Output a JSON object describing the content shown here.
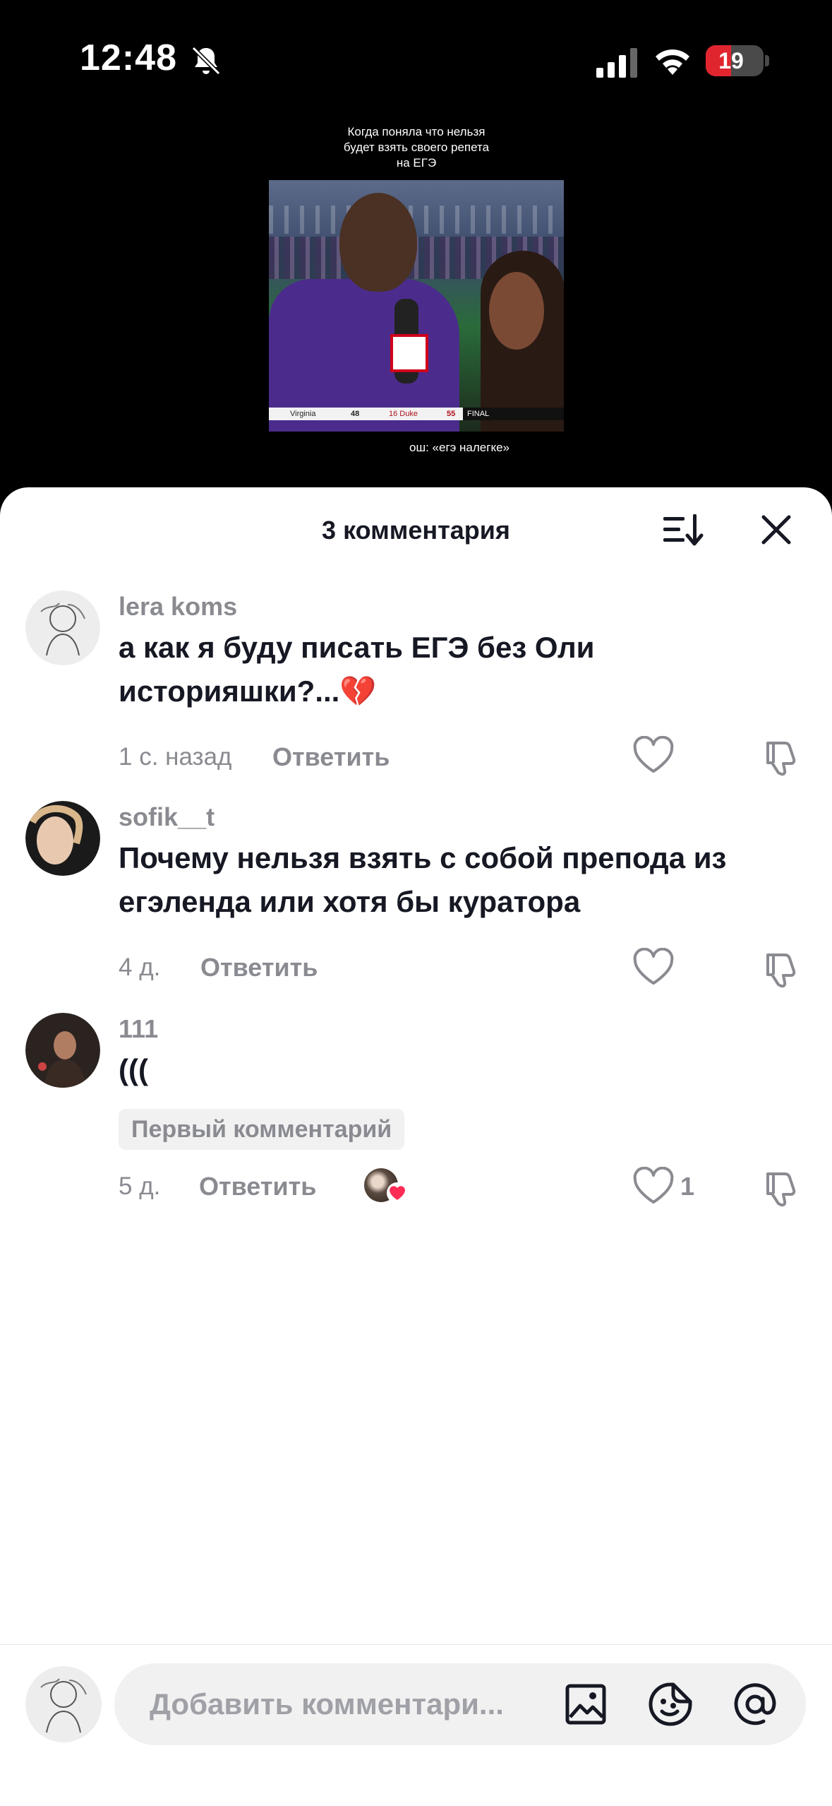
{
  "status_bar": {
    "time": "12:48",
    "battery_level": "19",
    "icons": [
      "bell-muted-icon",
      "cellular-signal-icon",
      "wifi-icon",
      "battery-icon"
    ],
    "battery_color": "#e1252f"
  },
  "video": {
    "caption_lines": [
      "Когда поняла что нельзя",
      "будет взять своего репета",
      "на ЕГЭ"
    ],
    "scoreboard": {
      "team1": "Virginia",
      "score1": "48",
      "team2": "16 Duke",
      "score2": "55",
      "status": "FINAL"
    },
    "subtitle": "ош: «егэ налегке»"
  },
  "sheet": {
    "title": "3 комментария",
    "sort_icon": "sort-icon",
    "close_icon": "close-icon"
  },
  "comments": [
    {
      "username": "lera koms",
      "text_line1": "а как я буду писать ЕГЭ без Оли",
      "text_line2": "историяшки?...💔",
      "time": "1 с. назад",
      "reply_label": "Ответить",
      "likes": ""
    },
    {
      "username": "sofik__t",
      "text_line1": "Почему нельзя взять с собой препода из",
      "text_line2": "егэленда или хотя бы куратора",
      "time": "4 д.",
      "reply_label": "Ответить",
      "likes": ""
    },
    {
      "username": "111",
      "text_line1": "(((",
      "badge": "Первый комментарий",
      "time": "5 д.",
      "reply_label": "Ответить",
      "likes": "1"
    }
  ],
  "input": {
    "placeholder": "Добавить комментари...",
    "icons": [
      "image-icon",
      "sticker-icon",
      "mention-icon"
    ]
  },
  "colors": {
    "heart_red": "#fe2c55",
    "text_primary": "#161823",
    "text_secondary": "#8a8b91"
  }
}
